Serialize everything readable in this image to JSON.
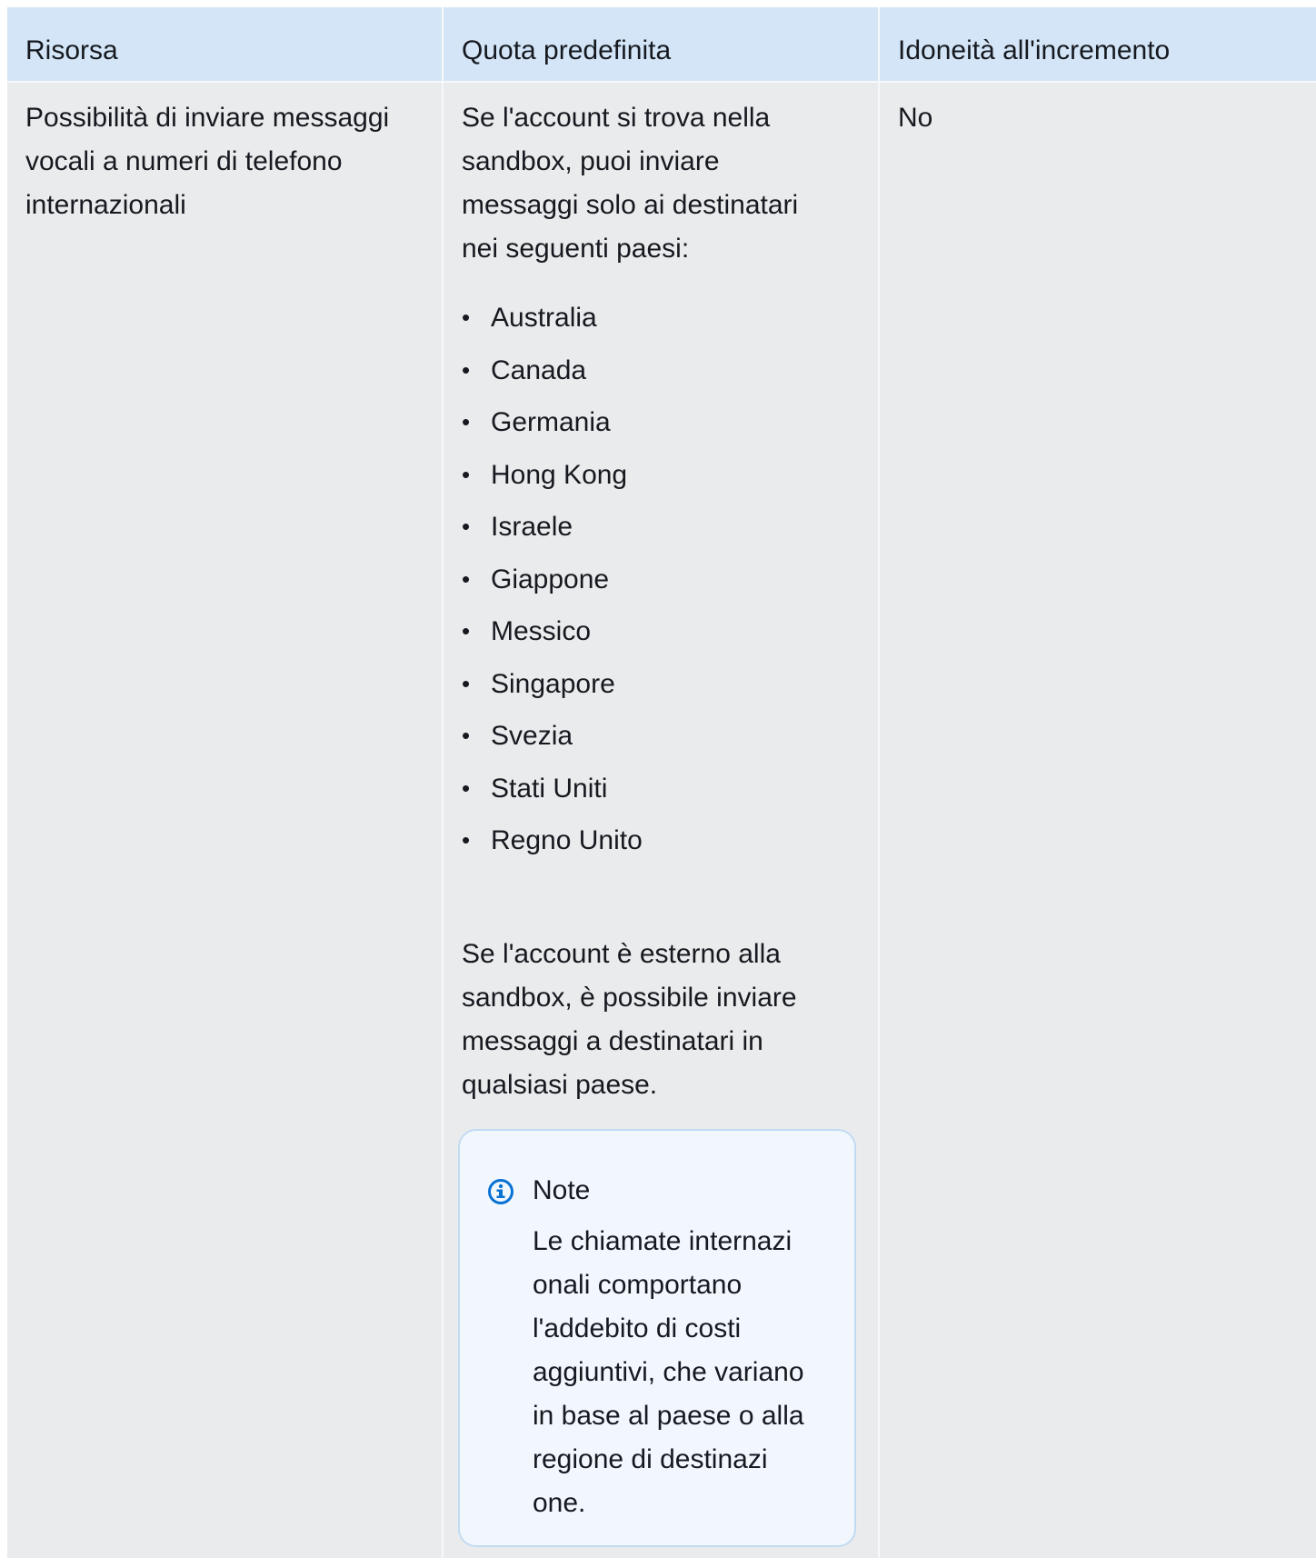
{
  "table": {
    "headers": [
      "Risorsa",
      "Quota predefinita",
      "Idoneità all'incremento"
    ],
    "row": {
      "resource_lines": [
        "Possibilità di inviare messaggi",
        "vocali a numeri di telefono",
        "internazionali"
      ],
      "quota_intro_lines": [
        "Se l'account si trova nella",
        "sandbox, puoi inviare",
        "messaggi solo ai destinatari",
        "nei seguenti paesi:"
      ],
      "countries": [
        "Australia",
        "Canada",
        "Germania",
        "Hong Kong",
        "Israele",
        "Giappone",
        "Messico",
        "Singapore",
        "Svezia",
        "Stati Uniti",
        "Regno Unito"
      ],
      "quota_outro_lines": [
        "Se l'account è esterno alla",
        "sandbox, è possibile inviare",
        "messaggi a destinatari in",
        "qualsiasi paese."
      ],
      "note": {
        "title": "Note",
        "icon": "info-icon",
        "body_lines": [
          "Le chiamate internazi",
          "onali comportano",
          "l'addebito di costi",
          "aggiuntivi, che variano",
          "in base al paese o alla",
          "regione di destinazi",
          "one."
        ]
      },
      "eligibility": "No"
    }
  },
  "colors": {
    "header_background": "#d3e5f7",
    "cell_background": "#eaebec",
    "note_background": "#f1f7fd",
    "note_border": "#c2dbf3",
    "info_icon": "#0972d3"
  }
}
